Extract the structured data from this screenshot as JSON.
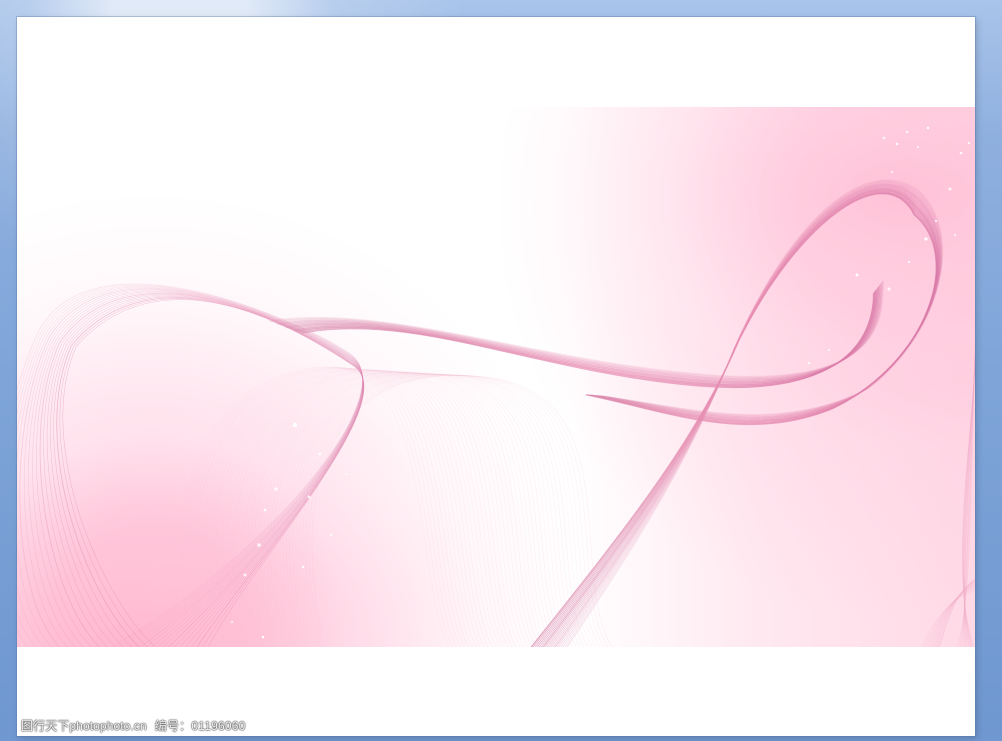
{
  "window": {
    "background_color": "#7ea4d8"
  },
  "slide": {
    "background_color": "#ffffff",
    "accent_color": "#e88db2",
    "secondary_accent_color": "#f4bfd3"
  },
  "watermark": {
    "site": "图行天下photophoto.cn",
    "code": "编号：01196060"
  }
}
